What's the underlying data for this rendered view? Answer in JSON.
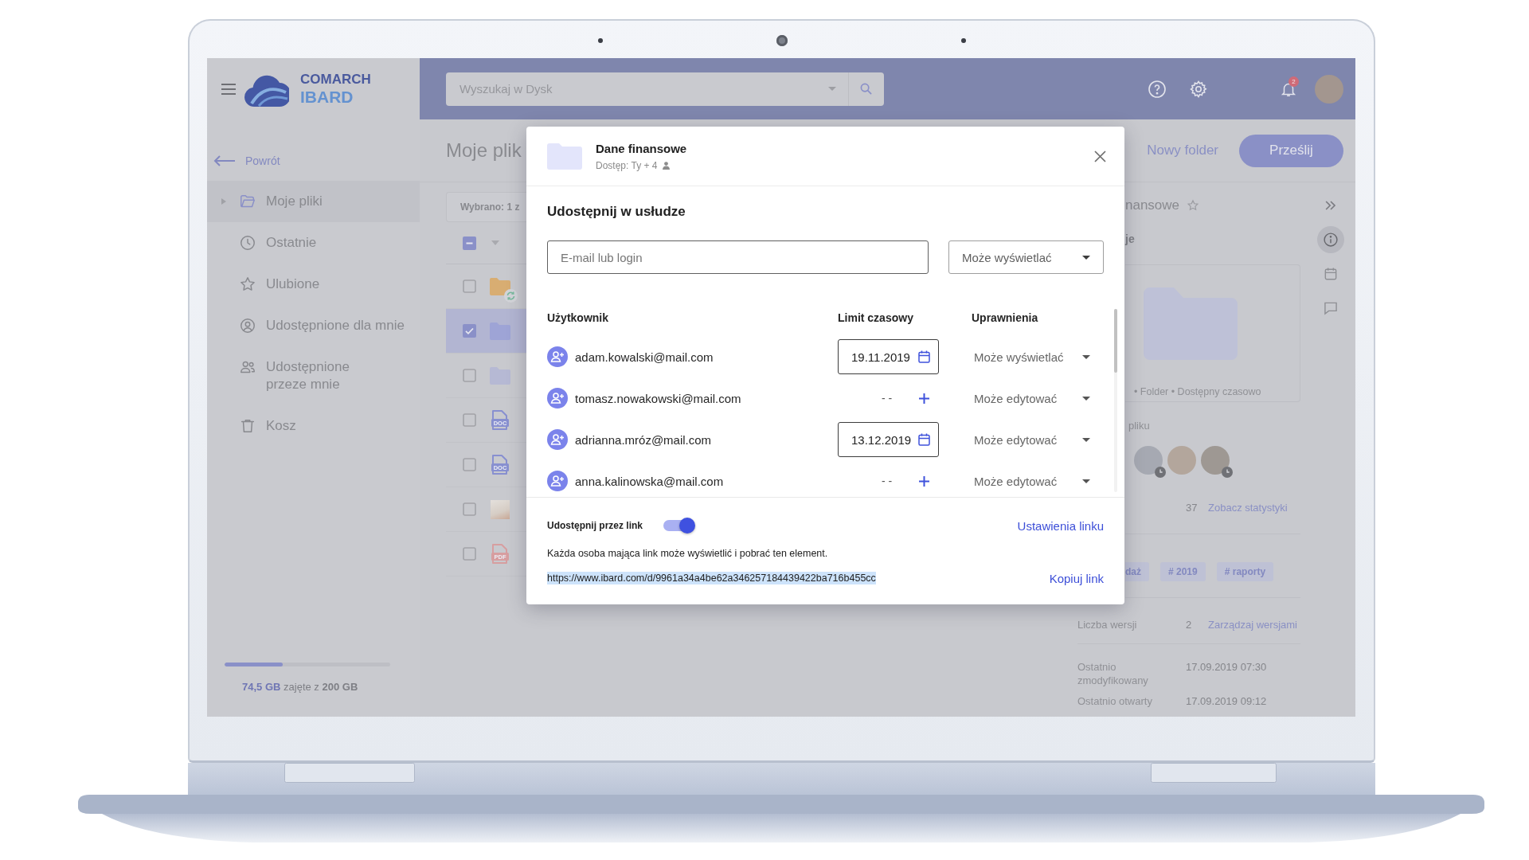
{
  "app": {
    "logo": {
      "company": "COMARCH",
      "product": "IBARD"
    },
    "search": {
      "placeholder": "Wyszukaj w Dysk"
    },
    "notifications": {
      "count": "2"
    }
  },
  "sidebar": {
    "back": "Powrót",
    "items": [
      {
        "kind": "folder",
        "label": "Moje pliki",
        "selected": true,
        "expanded": false
      },
      {
        "kind": "clock",
        "label": "Ostatnie",
        "selected": false
      },
      {
        "kind": "star",
        "label": "Ulubione",
        "selected": false
      },
      {
        "kind": "user",
        "label": "Udostępnione dla mnie",
        "selected": false
      },
      {
        "kind": "users",
        "label": "Udostępnione\nprzeze mnie",
        "selected": false
      },
      {
        "kind": "trash",
        "label": "Kosz",
        "selected": false
      }
    ],
    "storage": {
      "used": "74,5 GB",
      "total": "zajęte z **200 GB**",
      "level": 0.35
    }
  },
  "toolbar": {
    "title": "Moje plik",
    "new_folder": "Nowy folder",
    "upload": "Prześlij"
  },
  "file_list": {
    "selection": "Wybrano: 1 z",
    "select_all": {
      "indeterminate": true
    },
    "rows": [
      {
        "kind": "folder-synced",
        "selected": false,
        "checked": false
      },
      {
        "kind": "folder",
        "selected": true,
        "checked": true
      },
      {
        "kind": "folder-light",
        "selected": false,
        "checked": false
      },
      {
        "kind": "doc",
        "type_label": "DOC",
        "selected": false,
        "checked": false
      },
      {
        "kind": "doc",
        "type_label": "DOC",
        "selected": false,
        "checked": false
      },
      {
        "kind": "image",
        "selected": false,
        "checked": false
      },
      {
        "kind": "pdf",
        "type_label": "PDF",
        "selected": false,
        "checked": false
      }
    ]
  },
  "details": {
    "title": "nansowe",
    "favorite": false,
    "section": "je",
    "caption": "• Folder • Dostępny czasowo",
    "access_label": "pliku",
    "people": [
      {
        "clock": true
      },
      {
        "clock": false
      },
      {
        "clock": true
      }
    ],
    "stats": {
      "count": "37",
      "link": "Zobacz statystyki"
    },
    "tags": [
      "daż",
      "# 2019",
      "# raporty"
    ],
    "versions": {
      "label": "Liczba wersji",
      "count": "2",
      "link": "Zarządzaj wersjami"
    },
    "dates": [
      {
        "label": "Ostatnio zmodyfikowany",
        "value": "17.09.2019 07:30"
      },
      {
        "label": "Ostatnio otwarty",
        "value": "17.09.2019 09:12"
      }
    ]
  },
  "rail": [
    {
      "kind": "info",
      "selected": true
    },
    {
      "kind": "calendar",
      "selected": false
    },
    {
      "kind": "comment",
      "selected": false
    }
  ],
  "share_dialog": {
    "folder_name": "Dane finansowe",
    "access": "Dostęp: Ty + 4",
    "heading": "Udostępnij w usłudze",
    "invite": {
      "placeholder": "E-mail lub login",
      "permission": "Może wyświetlać"
    },
    "columns": [
      "Użytkownik",
      "Limit czasowy",
      "Uprawnienia"
    ],
    "users": [
      {
        "email": "adam.kowalski@mail.com",
        "kind": "date",
        "limit": "19.11.2019",
        "permission": "Może wyświetlać"
      },
      {
        "email": "tomasz.nowakowski@mail.com",
        "kind": "none",
        "limit": "- -",
        "permission": "Może edytować"
      },
      {
        "email": "adrianna.mróz@mail.com",
        "kind": "date",
        "limit": "13.12.2019",
        "permission": "Może edytować"
      },
      {
        "email": "anna.kalinowska@mail.com",
        "kind": "none",
        "limit": "- -",
        "permission": "Może edytować"
      }
    ],
    "link_sharing": {
      "label": "Udostępnij przez link",
      "on": true,
      "settings": "Ustawienia linku",
      "description": "Każda osoba mająca link może wyświetlić i pobrać ten element.",
      "url": "https://www.ibard.com/d/9961a34a4be62a346257184439422ba716b455cc",
      "url_selected": true,
      "copy": "Kopiuj link"
    }
  }
}
